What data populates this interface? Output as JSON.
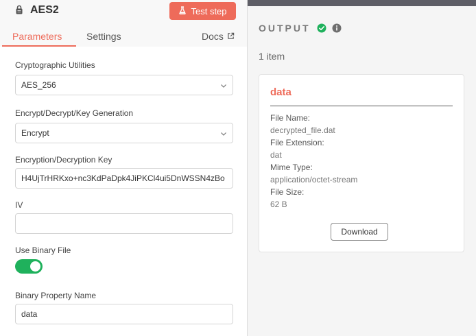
{
  "node": {
    "title": "AES2",
    "test_button_label": "Test step"
  },
  "tabs": {
    "parameters": "Parameters",
    "settings": "Settings",
    "docs": "Docs"
  },
  "fields": {
    "crypto_utilities": {
      "label": "Cryptographic Utilities",
      "value": "AES_256"
    },
    "operation": {
      "label": "Encrypt/Decrypt/Key Generation",
      "value": "Encrypt"
    },
    "key": {
      "label": "Encryption/Decryption Key",
      "value": "H4UjTrHRKxo+nc3KdPaDpk4JiPKCl4ui5DnWSSN4zBo"
    },
    "iv": {
      "label": "IV",
      "value": ""
    },
    "use_binary": {
      "label": "Use Binary File",
      "enabled": true
    },
    "binary_property": {
      "label": "Binary Property Name",
      "value": "data"
    }
  },
  "output": {
    "title": "OUTPUT",
    "item_count": "1 item",
    "status_color": "#1fb15c",
    "file": {
      "name": "data",
      "file_name_label": "File Name:",
      "file_name": "decrypted_file.dat",
      "extension_label": "File Extension:",
      "extension": "dat",
      "mime_label": "Mime Type:",
      "mime": "application/octet-stream",
      "size_label": "File Size:",
      "size": "62 B",
      "download_label": "Download"
    }
  },
  "colors": {
    "accent": "#ee6b5a",
    "toggle_on": "#1fb15c"
  }
}
